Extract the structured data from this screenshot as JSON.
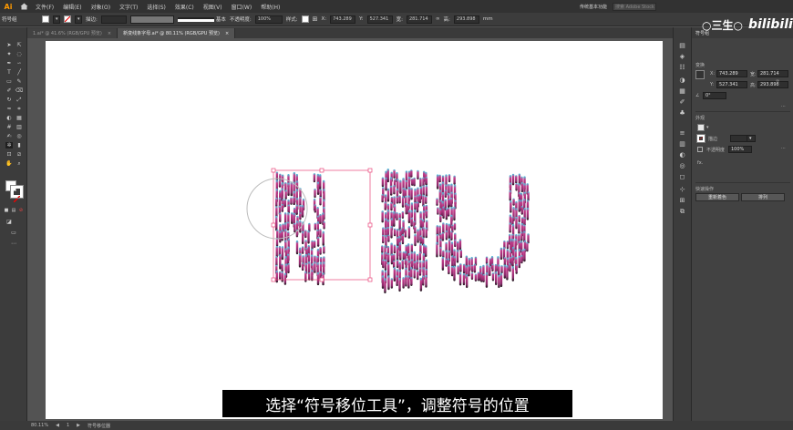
{
  "app": {
    "logo": "Ai"
  },
  "menu": {
    "items": [
      "文件(F)",
      "编辑(E)",
      "对象(O)",
      "文字(T)",
      "选择(S)",
      "效果(C)",
      "视图(V)",
      "窗口(W)",
      "帮助(H)"
    ],
    "workspace": "传统基本功能",
    "search_placeholder": "搜索 Adobe Stock"
  },
  "control_bar": {
    "label": "符号组",
    "stroke_label": "描边:",
    "stroke_style": "基本",
    "opacity_label": "不透明度:",
    "opacity_value": "100%",
    "style_label": "样式:",
    "x_label": "X:",
    "x_value": "743.289",
    "y_label": "Y:",
    "y_value": "527.341",
    "w_label": "宽:",
    "w_value": "281.714",
    "h_label": "高:",
    "h_value": "293.898",
    "h_unit": "mm"
  },
  "tabs": [
    {
      "label": "1.ai* @ 41.6% (RGB/GPU 预览)",
      "active": false
    },
    {
      "label": "新变线条字母.ai* @ 80.11% (RGB/GPU 预览)",
      "active": true
    }
  ],
  "panel": {
    "tab": "符号组",
    "transform_title": "变换",
    "x_label": "X:",
    "x_value": "743.289",
    "y_label": "Y:",
    "y_value": "527.341",
    "w_label": "宽:",
    "w_value": "281.714",
    "h_label": "高:",
    "h_value": "293.898",
    "angle_value": "0°",
    "appearance_title": "外观",
    "stroke_label": "描边",
    "opacity_label": "不透明度",
    "opacity_value": "100%",
    "fx_label": "fx.",
    "quick_actions_title": "快速操作",
    "btn_expand": "重新着色",
    "btn_arrange": "排列"
  },
  "status": {
    "zoom": "80.11%",
    "page": "1",
    "tool_name": "符号移位器"
  },
  "subtitle": "选择“符号移位工具”，调整符号的位置",
  "watermark": {
    "left": "○三生○",
    "right": "bilibili"
  },
  "artwork": {
    "letters": [
      "N",
      "I",
      "U"
    ],
    "colors": {
      "pink": "#c43b8a",
      "cyan": "#3fd0e6",
      "dark": "#1a1a1a",
      "selection": "#e8457a"
    }
  }
}
